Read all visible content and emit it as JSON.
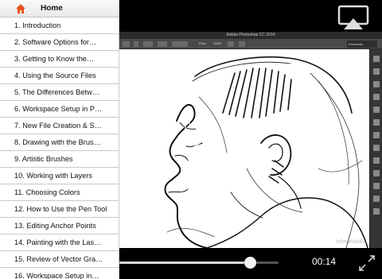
{
  "menu": {
    "home_label": "Home",
    "home_icon": "home-icon",
    "accent_color": "#e8531e",
    "items": [
      "1. Introduction",
      "2. Software Options for…",
      "3. Getting to Know the…",
      "4. Using the Source Files",
      "5. The Differences Betw…",
      "6. Workspace Setup in P…",
      "7. New File Creation & S…",
      "8. Drawing with the Brus…",
      "9. Artistic Brushes",
      "10. Working with Layers",
      "11. Choosing Colors",
      "12. How to Use the Pen Tool",
      "13. Editing Anchor Points",
      "14. Painting with the Las…",
      "15. Review of Vector Gra…",
      "16. Workspace Setup in…"
    ]
  },
  "video": {
    "app_title": "Adobe Photoshop CC 2014",
    "flow_label": "Flow:",
    "flow_value": "100%",
    "workspace_select": "Essentials",
    "watermark": "infiniteskills"
  },
  "player": {
    "time": "00:14",
    "progress": 0.82,
    "icons": [
      "airplay-icon",
      "rewind-icon",
      "play-icon",
      "fast-forward-icon",
      "fullscreen-icon"
    ]
  }
}
